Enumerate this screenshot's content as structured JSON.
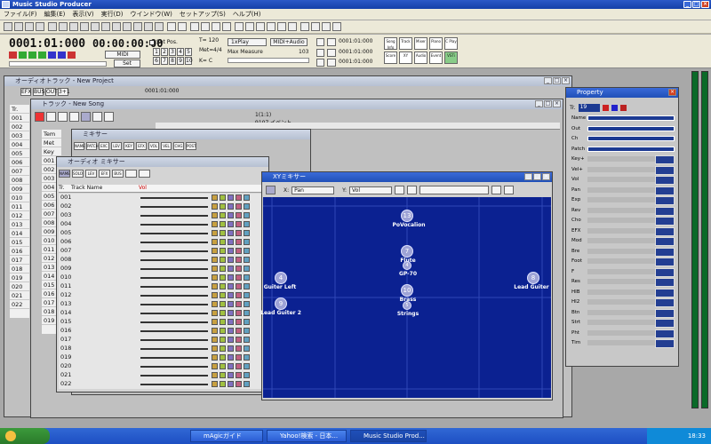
{
  "app": {
    "title": "Music Studio Producer",
    "menu": [
      "ファイル(F)",
      "編集(E)",
      "表示(V)",
      "実行(D)",
      "ウインドウ(W)",
      "セットアップ(S)",
      "ヘルプ(H)"
    ]
  },
  "transport": {
    "position": "0001:01:000",
    "time": "00:00:00:00",
    "set_pos_label": "Set Pos.",
    "midi_label": "MIDI",
    "set_label": "Set",
    "tempo": "T= 120",
    "meter_label": "Met=",
    "meter_value": "4/4",
    "key": "K= C",
    "numpad": [
      "1",
      "2",
      "3",
      "4",
      "5",
      "6",
      "7",
      "8",
      "9",
      "10"
    ],
    "play_mode": "1xPlay",
    "midi_audio": "MIDI+Audio",
    "max_measure_label": "Max Measure",
    "max_measure_value": "103",
    "markers": [
      "0001:01:000",
      "0001:01:000",
      "0001:01:000"
    ],
    "right_buttons": [
      "Song Info",
      "Track",
      "Mixer",
      "Piano",
      "C Play",
      "Score",
      "XY",
      "Audio",
      "Event",
      "VSTi"
    ]
  },
  "audio_track_window": {
    "title": "オーディオトラック - New Project",
    "buttons": [
      "EFX",
      "BUS",
      "OUT",
      "3+1"
    ],
    "position": "0001:01:000",
    "rows": [
      "001",
      "002",
      "003",
      "004",
      "005",
      "006",
      "007",
      "008",
      "009",
      "010",
      "011",
      "012",
      "013",
      "014",
      "015",
      "016",
      "017",
      "018",
      "019",
      "020",
      "021",
      "022"
    ],
    "header": "Tr."
  },
  "track_window": {
    "title": "トラック - New Song",
    "measure": "1(1:1)",
    "event_count": "9107 イベント",
    "rows": [
      "001",
      "002",
      "003",
      "004",
      "005",
      "006",
      "007",
      "008",
      "009",
      "010",
      "011",
      "012",
      "013",
      "014",
      "015",
      "016",
      "017",
      "018",
      "019",
      "020",
      "021",
      "022"
    ],
    "header": "Tr.",
    "field_labels": [
      "Tem",
      "Met",
      "Key"
    ]
  },
  "mixer_window": {
    "title": "ミキサー",
    "buttons": [
      "NAME",
      "PATCH",
      "EXC",
      "LEV",
      "KEY",
      "EFX",
      "VOL",
      "VEL",
      "CHG",
      "POST"
    ]
  },
  "audio_mixer_window": {
    "title": "オーディオ ミキサー",
    "buttons": [
      "NAME",
      "SOLO",
      "LEV",
      "EFX",
      "BUS"
    ],
    "columns": [
      "Tr.",
      "Track Name",
      "Vol"
    ],
    "rows": [
      "001",
      "002",
      "003",
      "004",
      "005",
      "006",
      "007",
      "008",
      "009",
      "010",
      "011",
      "012",
      "013",
      "014",
      "015",
      "016",
      "017",
      "018",
      "019",
      "020",
      "021",
      "022"
    ]
  },
  "xy_mixer": {
    "title": "XYミキサー",
    "x_label": "X:",
    "x_value": "Pan",
    "y_label": "Y:",
    "y_value": "Vol",
    "nodes": [
      {
        "id": "13",
        "label": "PoVocalion"
      },
      {
        "id": "7",
        "label": "Flute"
      },
      {
        "id": "4",
        "label": "GP-70"
      },
      {
        "id": "4",
        "label": "Guiter Left"
      },
      {
        "id": "8",
        "label": "Lead Guiter"
      },
      {
        "id": "10",
        "label": "Brass"
      },
      {
        "id": "5",
        "label": "Strings"
      },
      {
        "id": "9",
        "label": "Lead Guiter 2"
      }
    ]
  },
  "property": {
    "title": "Property",
    "track_number": "19",
    "rows": [
      "Name",
      "Out",
      "Ch",
      "Patch",
      "Key+",
      "Vel+",
      "Vol",
      "Pan",
      "Exp",
      "Rev",
      "Cho",
      "EFX",
      "Mod",
      "Bre",
      "Foot",
      "F",
      "Res",
      "HIB",
      "HI2",
      "Btn",
      "Strt",
      "Pht",
      "Tim"
    ]
  },
  "taskbar": {
    "start": "",
    "tasks": [
      "mAgicガイド",
      "Yahoo!検索 - 日本...",
      "Music Studio Prod..."
    ],
    "clock": "18:33"
  }
}
